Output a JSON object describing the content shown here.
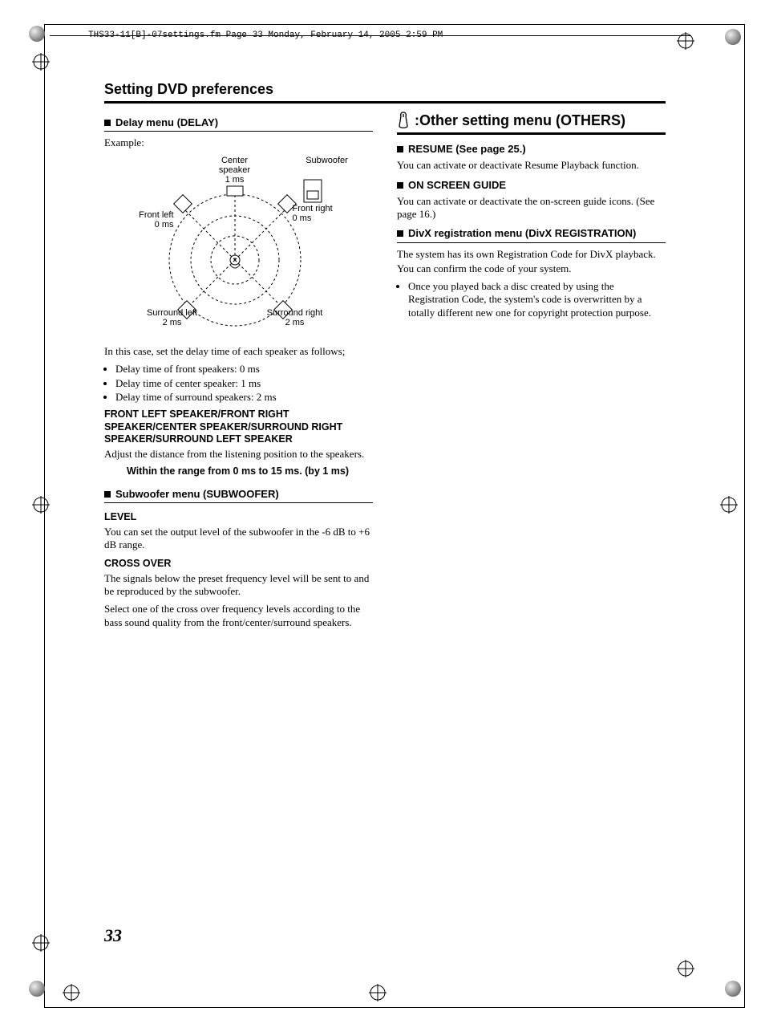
{
  "crop_header": "THS33-11[B]-07settings.fm  Page 33  Monday, February 14, 2005  2:59 PM",
  "page_title": "Setting DVD preferences",
  "page_number": "33",
  "left": {
    "delay_heading": "Delay menu (DELAY)",
    "example_label": "Example:",
    "diagram": {
      "center": "Center\nspeaker\n1 ms",
      "subwoofer": "Subwoofer",
      "front_left": "Front left\n0 ms",
      "front_right": "Front right\n0 ms",
      "surround_left": "Surround left\n2 ms",
      "surround_right": "Surround right\n2 ms"
    },
    "in_this_case": "In this case, set the delay time of each speaker as follows;",
    "delay_bullets": [
      "Delay time of front speakers:   0 ms",
      "Delay time of center speaker:   1 ms",
      "Delay time of surround speakers: 2 ms"
    ],
    "speaker_list_heading": "FRONT LEFT SPEAKER/FRONT RIGHT SPEAKER/CENTER SPEAKER/SURROUND RIGHT SPEAKER/SURROUND LEFT SPEAKER",
    "adjust_text": "Adjust the distance from the listening position to the speakers.",
    "range_text": "Within the range from 0 ms to 15 ms. (by 1 ms)",
    "subwoofer_heading": "Subwoofer menu (SUBWOOFER)",
    "level_heading": "LEVEL",
    "level_text": "You can set the output level of the subwoofer in the -6 dB to +6 dB range.",
    "crossover_heading": "CROSS OVER",
    "crossover_text1": "The signals below the preset frequency level will be sent to and be reproduced by the subwoofer.",
    "crossover_text2": "Select one of the cross over frequency levels according to the bass sound quality from the front/center/surround speakers."
  },
  "right": {
    "others_heading": ":Other setting menu (OTHERS)",
    "resume_heading": "RESUME (See page 25.)",
    "resume_text": "You can activate or deactivate Resume Playback function.",
    "osg_heading": "ON SCREEN GUIDE",
    "osg_text": "You can activate or deactivate the on-screen guide icons. (See page 16.)",
    "divx_heading": "DivX registration menu (DivX REGISTRATION)",
    "divx_text1": "The system has its own Registration Code for DivX playback.",
    "divx_text2": "You can confirm the code of your system.",
    "divx_bullet": "Once you played back a disc created by using the Registration Code, the system's code is overwritten by a totally different new one for copyright protection purpose."
  }
}
